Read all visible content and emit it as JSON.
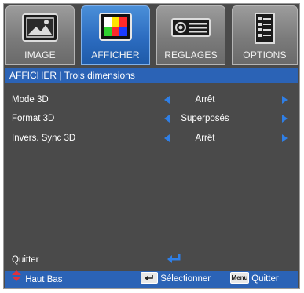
{
  "tabs": [
    {
      "label": "IMAGE",
      "icon": "picture-frame-icon",
      "active": false
    },
    {
      "label": "AFFICHER",
      "icon": "color-bars-display-icon",
      "active": true
    },
    {
      "label": "REGLAGES",
      "icon": "projector-icon",
      "active": false
    },
    {
      "label": "OPTIONS",
      "icon": "checklist-icon",
      "active": false
    }
  ],
  "title": "AFFICHER | Trois dimensions",
  "menu": [
    {
      "label": "Mode 3D",
      "value": "Arrêt"
    },
    {
      "label": "Format 3D",
      "value": "Superposés"
    },
    {
      "label": "Invers. Sync 3D",
      "value": "Arrêt"
    }
  ],
  "quit_label": "Quitter",
  "footer": {
    "nav_label": "Haut Bas",
    "select_label": "Sélectionner",
    "menu_key": "Menu",
    "quit_label": "Quitter"
  },
  "colors": {
    "accent": "#2b63b6",
    "arrow": "#2f7fe6",
    "panel": "#4a4a4a",
    "nav_arrow": "#e0313a"
  }
}
